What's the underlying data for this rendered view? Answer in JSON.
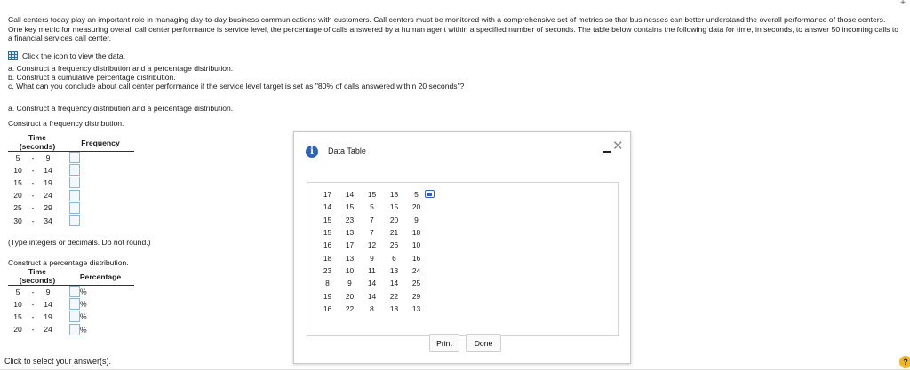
{
  "intro": "Call centers today play an important role in managing day-to-day business communications with customers. Call centers must be monitored with a comprehensive set of metrics so that businesses can better understand the overall performance of those centers. One key metric for measuring overall call center performance is service level, the percentage of calls answered by a human agent within a specified number of seconds. The table below contains the following data for time, in seconds, to answer 50 incoming calls to a financial services call center.",
  "view_data": "Click the icon to view the data.",
  "tasks": {
    "a": "a. Construct a frequency distribution and a percentage distribution.",
    "b": "b. Construct a cumulative percentage distribution.",
    "c": "c. What can you conclude about call center performance if the service level target is set as \"80% of calls answered within 20 seconds\"?"
  },
  "part_a": {
    "heading": "a. Construct a frequency distribution and a percentage distribution.",
    "freq_label": "Construct a frequency distribution.",
    "time_header": "Time",
    "seconds_header": "(seconds)",
    "freq_header": "Frequency",
    "ranges": [
      [
        "5",
        "9"
      ],
      [
        "10",
        "14"
      ],
      [
        "15",
        "19"
      ],
      [
        "20",
        "24"
      ],
      [
        "25",
        "29"
      ],
      [
        "30",
        "34"
      ]
    ],
    "dash": "-",
    "note": "(Type integers or decimals. Do not round.)",
    "pct_label": "Construct a percentage distribution.",
    "pct_header": "Percentage",
    "pct_ranges": [
      [
        "5",
        "9"
      ],
      [
        "10",
        "14"
      ],
      [
        "15",
        "19"
      ],
      [
        "20",
        "24"
      ]
    ],
    "pct_sign": "%"
  },
  "modal": {
    "title": "Data Table",
    "rows": [
      [
        "17",
        "14",
        "15",
        "18",
        "5"
      ],
      [
        "14",
        "15",
        "5",
        "15",
        "20"
      ],
      [
        "15",
        "23",
        "7",
        "20",
        "9"
      ],
      [
        "15",
        "13",
        "7",
        "21",
        "18"
      ],
      [
        "16",
        "17",
        "12",
        "26",
        "10"
      ],
      [
        "18",
        "13",
        "9",
        "6",
        "16"
      ],
      [
        "23",
        "10",
        "11",
        "13",
        "24"
      ],
      [
        "8",
        "9",
        "14",
        "14",
        "25"
      ],
      [
        "19",
        "20",
        "14",
        "22",
        "29"
      ],
      [
        "16",
        "22",
        "8",
        "18",
        "13"
      ]
    ],
    "print_label": "Print",
    "done_label": "Done"
  },
  "footer": "Click to select your answer(s).",
  "help_glyph": "?"
}
